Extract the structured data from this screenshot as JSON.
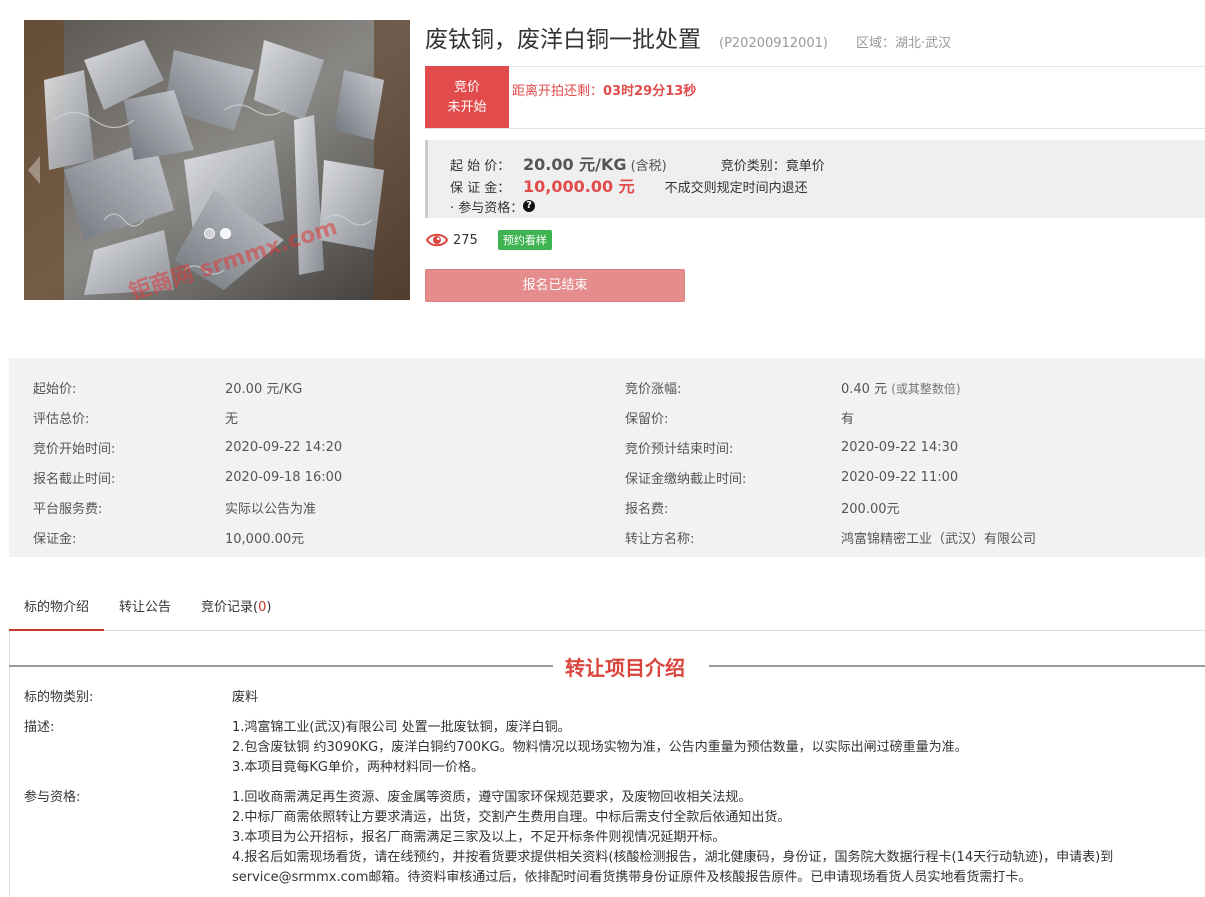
{
  "product": {
    "title": "废钛铜，废洋白铜一批处置",
    "code": "(P20200912001)",
    "region_label": "区域：",
    "region": "湖北·武汉",
    "image_watermark": "钜商网 srmmx.com"
  },
  "status": {
    "line1": "竞价",
    "line2": "未开始",
    "countdown_label": "距离开拍还剩：",
    "countdown_value": "03时29分13秒"
  },
  "price_panel": {
    "start_label": "起 始 价：",
    "start_price": "20.00 元/KG",
    "tax_note": "(含税)",
    "type_label": "竞价类别：",
    "type_value": "竟单价",
    "deposit_label": "保 证 金：",
    "deposit_value": "10,000.00 元",
    "refund_note": "不成交则规定时间内退还",
    "qualification_label": "· 参与资格：",
    "qualification_icon": "question-circle-icon"
  },
  "stats": {
    "view_icon": "eye-icon",
    "views": "275",
    "preview_badge": "预约看样"
  },
  "register_button": "报名已结束",
  "info_grid": [
    {
      "l1": "起始价:",
      "v1": "20.00 元/KG",
      "l2": "竞价涨幅:",
      "v2": "0.40 元",
      "v2_note": "(或其整数倍)"
    },
    {
      "l1": "评估总价:",
      "v1": "无",
      "l2": "保留价:",
      "v2": "有",
      "v2_note": ""
    },
    {
      "l1": "竞价开始时间:",
      "v1": "2020-09-22 14:20",
      "l2": "竞价预计结束时间:",
      "v2": "2020-09-22 14:30",
      "v2_note": ""
    },
    {
      "l1": "报名截止时间:",
      "v1": "2020-09-18 16:00",
      "l2": "保证金缴纳截止时间:",
      "v2": "2020-09-22 11:00",
      "v2_note": ""
    },
    {
      "l1": "平台服务费:",
      "v1": "实际以公告为准",
      "l2": "报名费:",
      "v2": "200.00元",
      "v2_note": ""
    },
    {
      "l1": "保证金:",
      "v1": "10,000.00元",
      "l2": "转让方名称:",
      "v2": "鸿富锦精密工业（武汉）有限公司",
      "v2_note": ""
    }
  ],
  "tabs": [
    {
      "label": "标的物介绍",
      "count": ""
    },
    {
      "label": "转让公告",
      "count": ""
    },
    {
      "label": "竞价记录(",
      "count": "0",
      "suffix": ")"
    }
  ],
  "intro": {
    "section_title": "转让项目介绍",
    "category_label": "标的物类别:",
    "category_value": "废料",
    "desc_label": "描述:",
    "desc_lines": [
      "1.鸿富锦工业(武汉)有限公司 处置一批废钛铜，废洋白铜。",
      "2.包含废钛铜 约3090KG，废洋白铜约700KG。物料情况以现场实物为准，公告内重量为预估数量，以实际出闸过磅重量为准。",
      "3.本项目竟每KG单价，两种材料同一价格。"
    ],
    "qual_label": "参与资格:",
    "qual_lines": [
      "1.回收商需满足再生资源、废金属等资质，遵守国家环保规范要求，及废物回收相关法规。",
      "2.中标厂商需依照转让方要求清运，出货，交割产生费用自理。中标后需支付全款后依通知出货。",
      "3.本项目为公开招标，报名厂商需满足三家及以上，不足开标条件则视情况延期开标。",
      "4.报名后如需现场看货，请在线预约，并按看货要求提供相关资料(核酸检测报告，湖北健康码，身份证，国务院大数据行程卡(14天行动轨迹)，申请表)到service@srmmx.com邮箱。待资料审核通过后，依排配时间看货携带身份证原件及核酸报告原件。已申请现场看货人员实地看货需打卡。"
    ]
  }
}
